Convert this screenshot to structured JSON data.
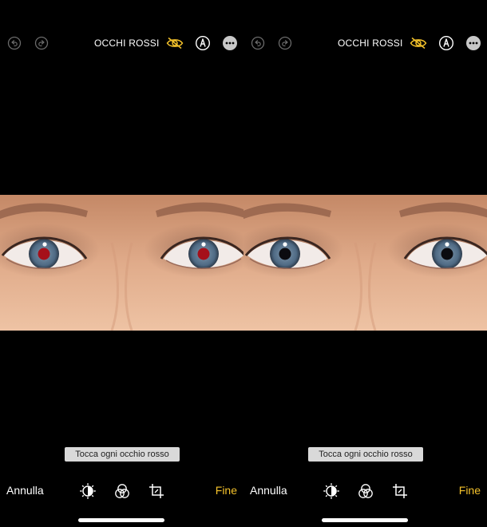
{
  "screens": [
    {
      "title": "OCCHI ROSSI",
      "hint": "Tocca ogni occhio rosso",
      "cancel_label": "Annulla",
      "done_label": "Fine",
      "pupil_color": "#a5101a",
      "state": "before"
    },
    {
      "title": "OCCHI ROSSI",
      "hint": "Tocca ogni occhio rosso",
      "cancel_label": "Annulla",
      "done_label": "Fine",
      "pupil_color": "#0b0b10",
      "state": "after"
    }
  ],
  "colors": {
    "accent": "#f4c22b",
    "background": "#000000",
    "hint_bg": "#d9d9d9",
    "disabled_icon": "#6a6a6a"
  },
  "icons": [
    "undo-icon",
    "redo-icon",
    "red-eye-icon",
    "markup-icon",
    "more-icon",
    "adjust-icon",
    "filters-icon",
    "crop-icon"
  ]
}
